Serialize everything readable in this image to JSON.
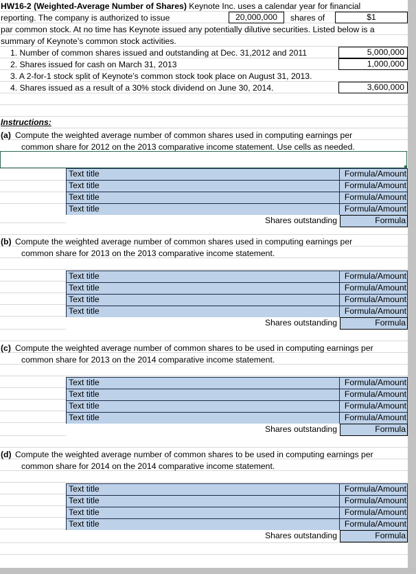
{
  "colors": {
    "cell_fill": "#bdd1e8",
    "cell_border": "#1c2b4a",
    "selection": "#2c6b4f",
    "scrollbar": "#c3c3c3",
    "gridline": "#d9d9d9"
  },
  "header": {
    "problem_id": "HW16-2 (Weighted-Average Number of Shares)",
    "line1_rest": " Keynote Inc. uses a calendar year for financial",
    "line2_before": "reporting. The company is authorized to issue",
    "authorized_shares": "20,000,000",
    "line2_mid": "shares of",
    "par_value": "$1",
    "line3": "par common stock. At no time has Keynote issued any potentially dilutive securities. Listed below is a",
    "line4": "summary of Keynote’s common stock activities."
  },
  "facts": [
    {
      "label": "1. Number of common shares issued and outstanding at Dec. 31,2012 and 2011",
      "value": "5,000,000",
      "has_box": true
    },
    {
      "label": "2. Shares issued for cash on March 31, 2013",
      "value": "1,000,000",
      "has_box": true
    },
    {
      "label": "3. A 2-for-1 stock split of Keynote’s common stock took place on August 31, 2013.",
      "value": "",
      "has_box": false
    },
    {
      "label": "4. Shares issued as a result of a 30% stock dividend on June 30, 2014.",
      "value": "3,600,000",
      "has_box": true
    }
  ],
  "instructions_heading": "Instructions:",
  "parts": [
    {
      "letter": "(a)",
      "line1": "Compute the weighted average number of common shares used in computing earnings per",
      "line2": "common share for 2012 on the 2013 comparative income statement. Use cells as needed.",
      "rows": [
        {
          "title": "Text title",
          "amount": "Formula/Amount"
        },
        {
          "title": "Text title",
          "amount": "Formula/Amount"
        },
        {
          "title": "Text title",
          "amount": "Formula/Amount"
        },
        {
          "title": "Text title",
          "amount": "Formula/Amount"
        }
      ],
      "total_label": "Shares outstanding",
      "total_value": "Formula"
    },
    {
      "letter": "(b)",
      "line1": "Compute the weighted average number of common shares used in computing earnings per",
      "line2": "common share for 2013 on the 2013 comparative income statement.",
      "rows": [
        {
          "title": "Text title",
          "amount": "Formula/Amount"
        },
        {
          "title": "Text title",
          "amount": "Formula/Amount"
        },
        {
          "title": "Text title",
          "amount": "Formula/Amount"
        },
        {
          "title": "Text title",
          "amount": "Formula/Amount"
        }
      ],
      "total_label": "Shares outstanding",
      "total_value": "Formula"
    },
    {
      "letter": "(c)",
      "line1": "Compute the weighted average number of common shares to be used in computing earnings per",
      "line2": "common share for 2013 on the 2014 comparative income statement.",
      "rows": [
        {
          "title": "Text title",
          "amount": "Formula/Amount"
        },
        {
          "title": "Text title",
          "amount": "Formula/Amount"
        },
        {
          "title": "Text title",
          "amount": "Formula/Amount"
        },
        {
          "title": "Text title",
          "amount": "Formula/Amount"
        }
      ],
      "total_label": "Shares outstanding",
      "total_value": "Formula"
    },
    {
      "letter": "(d)",
      "line1": "Compute the weighted average number of common shares to be used in computing earnings per",
      "line2": "common share for 2014 on the 2014 comparative income statement.",
      "rows": [
        {
          "title": "Text title",
          "amount": "Formula/Amount"
        },
        {
          "title": "Text title",
          "amount": "Formula/Amount"
        },
        {
          "title": "Text title",
          "amount": "Formula/Amount"
        },
        {
          "title": "Text title",
          "amount": "Formula/Amount"
        }
      ],
      "total_label": "Shares outstanding",
      "total_value": "Formula"
    }
  ]
}
